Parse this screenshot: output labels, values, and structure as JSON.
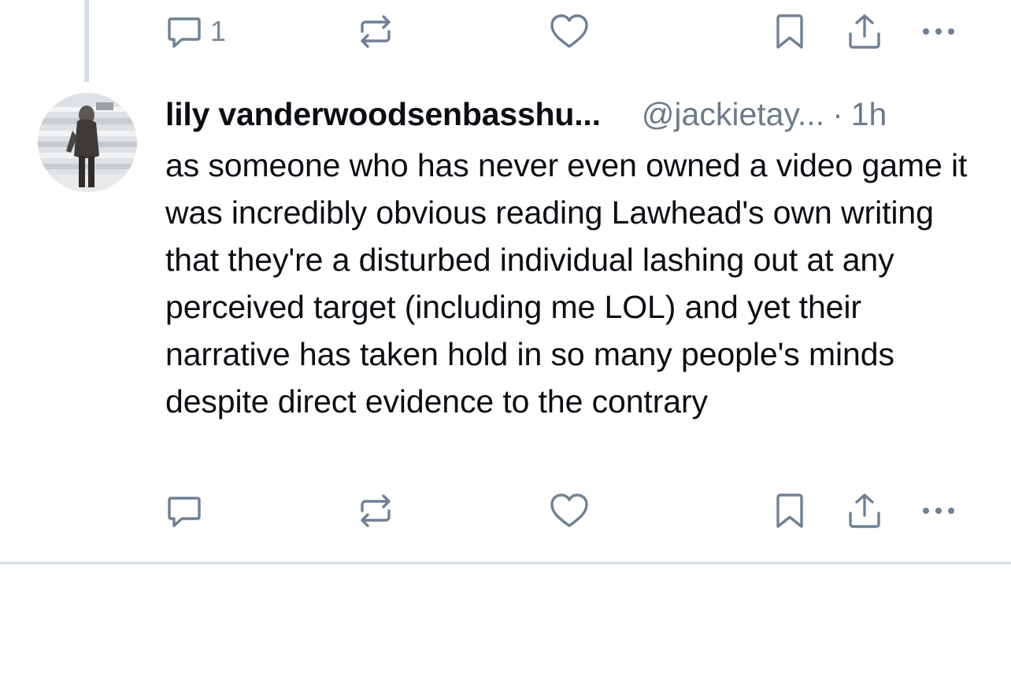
{
  "top_actions": {
    "reply_count": "1"
  },
  "post": {
    "display_name": "lily vanderwoodsenbasshu...",
    "handle": "@jackietay...",
    "separator": "·",
    "timestamp": "1h",
    "text": "as someone who has never even owned a video game it was incredibly obvious reading Lawhead's own writing that they're a disturbed individual lashing out at any perceived target (including me LOL) and yet their narrative has taken hold in so many people's minds despite direct evidence to the contrary"
  },
  "icons": {
    "reply": "reply-icon",
    "repost": "repost-icon",
    "like": "heart-icon",
    "bookmark": "bookmark-icon",
    "share": "share-icon",
    "more": "more-icon"
  },
  "colors": {
    "icon": "#6f8196",
    "text": "#0b0f14",
    "muted": "#6c7b8b",
    "divider": "#d4dbe2",
    "thread_line": "#d6dde5"
  }
}
